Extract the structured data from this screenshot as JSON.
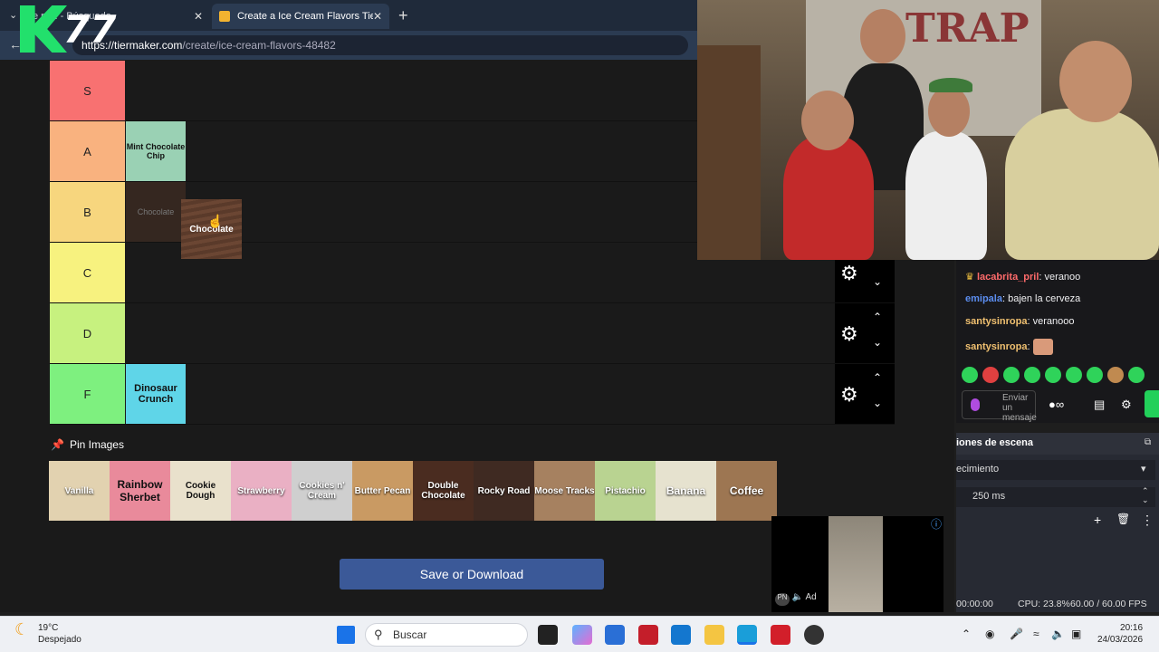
{
  "browser": {
    "tabs": [
      {
        "label": "e pr... - Búsqueda"
      },
      {
        "label": "Create a Ice Cream Flavors Tier List"
      }
    ],
    "url_host": "https://tiermaker.com",
    "url_path": "/create/ice-cream-flavors-48482"
  },
  "logo": {
    "number": "77"
  },
  "tiers": [
    {
      "label": "S",
      "color": "#f87171",
      "items": []
    },
    {
      "label": "A",
      "color": "#f9b27f",
      "items": [
        {
          "label": "Mint Chocolate Chip",
          "color": "#9ad1b4"
        }
      ]
    },
    {
      "label": "B",
      "color": "#f7d67e",
      "items": [
        {
          "label": "Chocolate",
          "color": "#3a2a22"
        }
      ]
    },
    {
      "label": "C",
      "color": "#f7f27f",
      "items": []
    },
    {
      "label": "D",
      "color": "#c7f17f",
      "items": []
    },
    {
      "label": "F",
      "color": "#7ef07f",
      "items": [
        {
          "label": "Dinosaur Crunch",
          "color": "#5fd5e8"
        }
      ]
    }
  ],
  "dragged_item": {
    "label": "Chocolate"
  },
  "pin_images": {
    "label": "Pin Images"
  },
  "pool": [
    {
      "label": "Vanilla",
      "color": "#e2d2b0"
    },
    {
      "label": "Rainbow Sherbet",
      "color": "#e98a9b"
    },
    {
      "label": "Cookie Dough",
      "color": "#e9e1cc"
    },
    {
      "label": "Strawberry",
      "color": "#eab0c4"
    },
    {
      "label": "Cookies n' Cream",
      "color": "#cfcfcf"
    },
    {
      "label": "Butter Pecan",
      "color": "#c99a63"
    },
    {
      "label": "Double Chocolate",
      "color": "#4a2c20"
    },
    {
      "label": "Rocky Road",
      "color": "#3f2a22"
    },
    {
      "label": "Moose Tracks",
      "color": "#a68160"
    },
    {
      "label": "Pistachio",
      "color": "#b9d391"
    },
    {
      "label": "Banana",
      "color": "#e6e2cf"
    },
    {
      "label": "Coffee",
      "color": "#9d7652"
    }
  ],
  "save_button": "Save or Download",
  "cam": {
    "graffiti": "TRAP"
  },
  "chat": {
    "messages": [
      {
        "user": "lacabrita_pril",
        "text": ": veranoo",
        "color": "#ff6b6b"
      },
      {
        "user": "emipala",
        "text": ": bajen la cerveza",
        "color": "#5b8def"
      },
      {
        "user": "santysinropa",
        "text": ": veranooo",
        "color": "#f0c070"
      },
      {
        "user": "santysinropa",
        "text": ":",
        "color": "#f0c070"
      }
    ],
    "input_placeholder": "Enviar un mensaje"
  },
  "obs": {
    "header": "iones de escena",
    "transition": "ecimiento",
    "duration": "250 ms",
    "status_time": "00:00:00",
    "cpu": "CPU: 23.8%",
    "fps": "60.00 / 60.00 FPS"
  },
  "ad": {
    "label": "Ad"
  },
  "taskbar": {
    "temp": "19°C",
    "condition": "Despejado",
    "search": "Buscar",
    "time": "20:16",
    "date": "24/03/2026"
  }
}
